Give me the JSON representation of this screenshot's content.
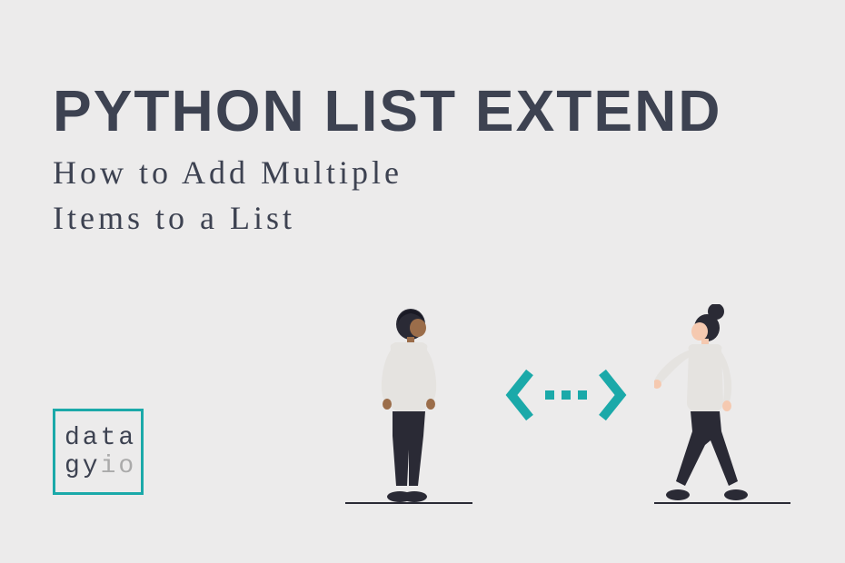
{
  "title": "PYTHON LIST EXTEND",
  "subtitle": "How to Add Multiple\nItems to a List",
  "logo": {
    "line1": "data",
    "line2_prefix": "gy",
    "line2_suffix": "io"
  },
  "colors": {
    "accent": "#1ba9a9",
    "text": "#3d4251",
    "background": "#ecebeb"
  }
}
